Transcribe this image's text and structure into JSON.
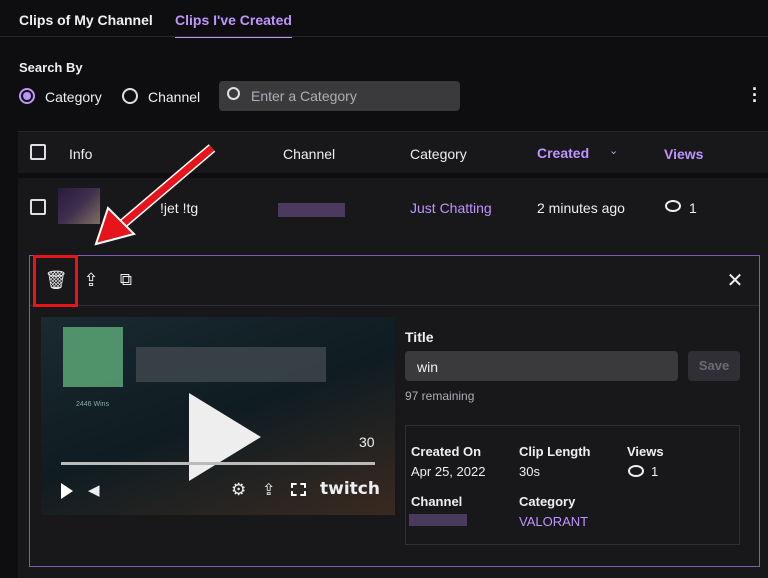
{
  "tabs": [
    {
      "label": "Clips of My Channel"
    },
    {
      "label": "Clips I've Created"
    }
  ],
  "search": {
    "label": "Search By",
    "options": [
      "Category",
      "Channel"
    ],
    "placeholder": "Enter a Category"
  },
  "table": {
    "headers": {
      "info": "Info",
      "channel": "Channel",
      "category": "Category",
      "created": "Created",
      "views": "Views"
    },
    "row": {
      "title": "!jet !tg",
      "category": "Just Chatting",
      "created": "2 minutes ago",
      "views": "1"
    }
  },
  "detail": {
    "title_label": "Title",
    "title_value": "win",
    "remaining": "97 remaining",
    "save": "Save",
    "created_on_label": "Created On",
    "created_on": "Apr 25, 2022",
    "clip_length_label": "Clip Length",
    "clip_length": "30s",
    "views_label": "Views",
    "views": "1",
    "channel_label": "Channel",
    "category_label": "Category",
    "category": "VALORANT"
  },
  "video": {
    "counter": "30",
    "overlay_text": "2446 Wins",
    "brand": "twitch"
  },
  "colors": {
    "accent": "#bf94ff",
    "annotation": "#e8141b"
  }
}
